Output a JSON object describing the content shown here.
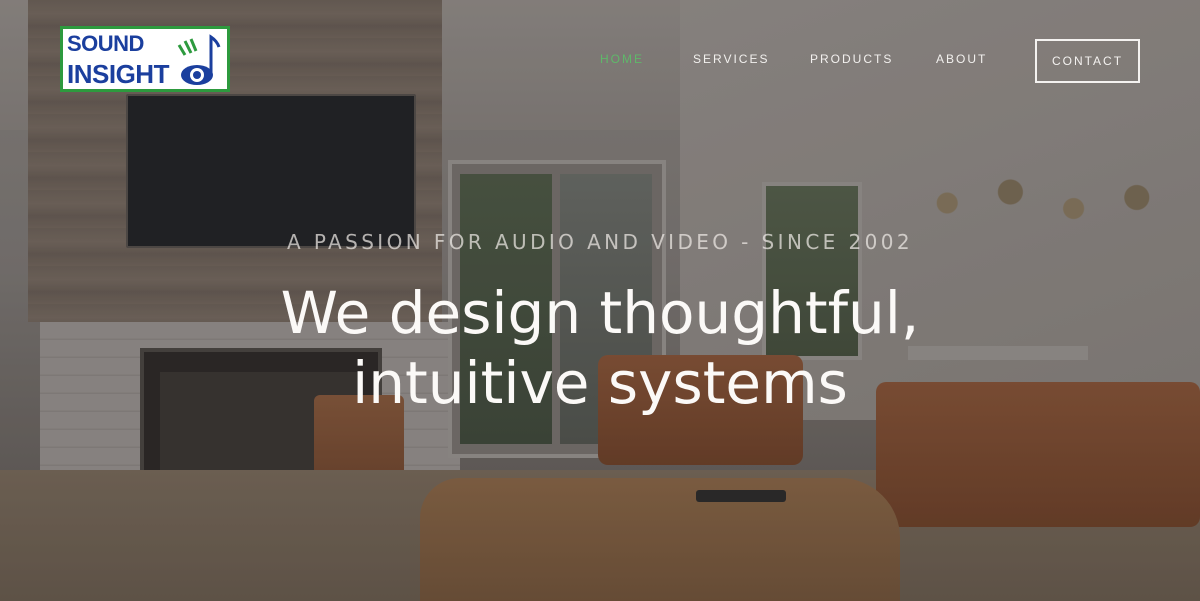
{
  "brand": {
    "line1": "SOUND",
    "line2": "INSIGHT",
    "green": "#2d9a3e",
    "blue": "#1b3f9e"
  },
  "nav": {
    "items": [
      {
        "label": "HOME",
        "active": true
      },
      {
        "label": "SERVICES",
        "active": false
      },
      {
        "label": "PRODUCTS",
        "active": false
      },
      {
        "label": "ABOUT",
        "active": false
      }
    ],
    "contact_label": "CONTACT",
    "active_color": "#5fb86a"
  },
  "hero": {
    "tagline": "A PASSION FOR AUDIO AND VIDEO - SINCE 2002",
    "headline_line1": "We design thoughtful,",
    "headline_line2": "intuitive systems"
  }
}
